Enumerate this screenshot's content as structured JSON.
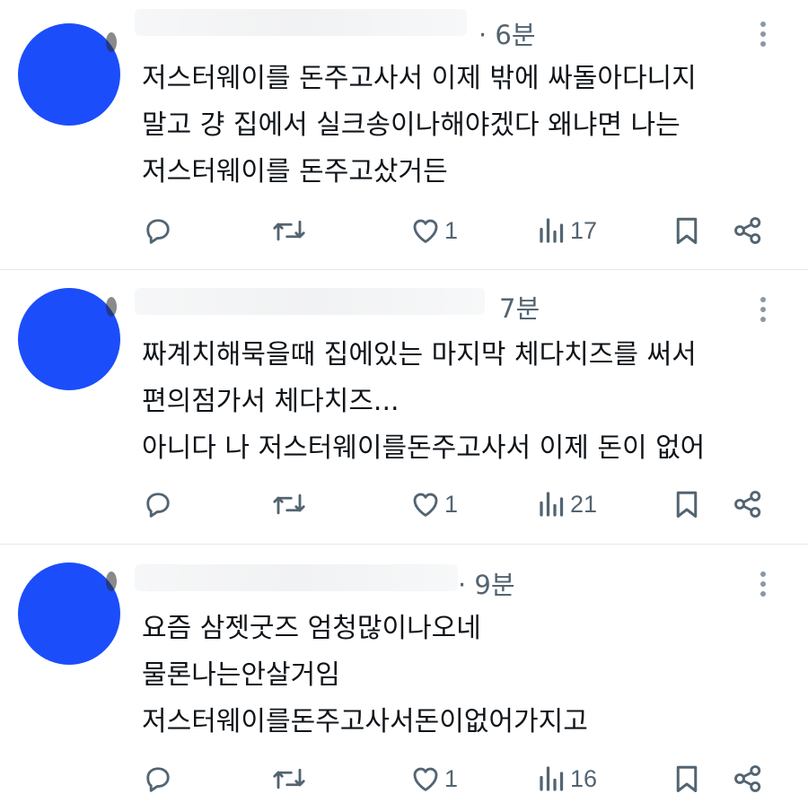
{
  "tweets": [
    {
      "time": "· 6분",
      "lines": [
        "저스터웨이를 돈주고사서 이제 밖에 싸돌아다니지",
        "말고 걍 집에서 실크송이나해야겠다 왜냐면 나는",
        "저스터웨이를 돈주고샀거든"
      ],
      "likes": "1",
      "views": "17"
    },
    {
      "time": "7분",
      "lines": [
        "짜계치해묵을때 집에있는 마지막 체다치즈를 써서",
        "편의점가서 체다치즈...",
        "아니다 나 저스터웨이를돈주고사서 이제 돈이 없어"
      ],
      "likes": "1",
      "views": "21"
    },
    {
      "time": "· 9분",
      "lines": [
        "요즘 삼젯굿즈 엄청많이나오네",
        "물론나는안살거임",
        "저스터웨이를돈주고사서돈이없어가지고"
      ],
      "likes": "1",
      "views": "16"
    }
  ],
  "icons": {
    "reply": "reply-icon",
    "retweet": "retweet-icon",
    "like": "heart-icon",
    "views": "views-chart-icon",
    "bookmark": "bookmark-icon",
    "share": "share-icon",
    "more": "more-vertical-icon"
  },
  "colors": {
    "avatar": "#1b4dfa",
    "icon": "#536471",
    "text": "#0f1419",
    "divider": "#e6e9ec"
  }
}
